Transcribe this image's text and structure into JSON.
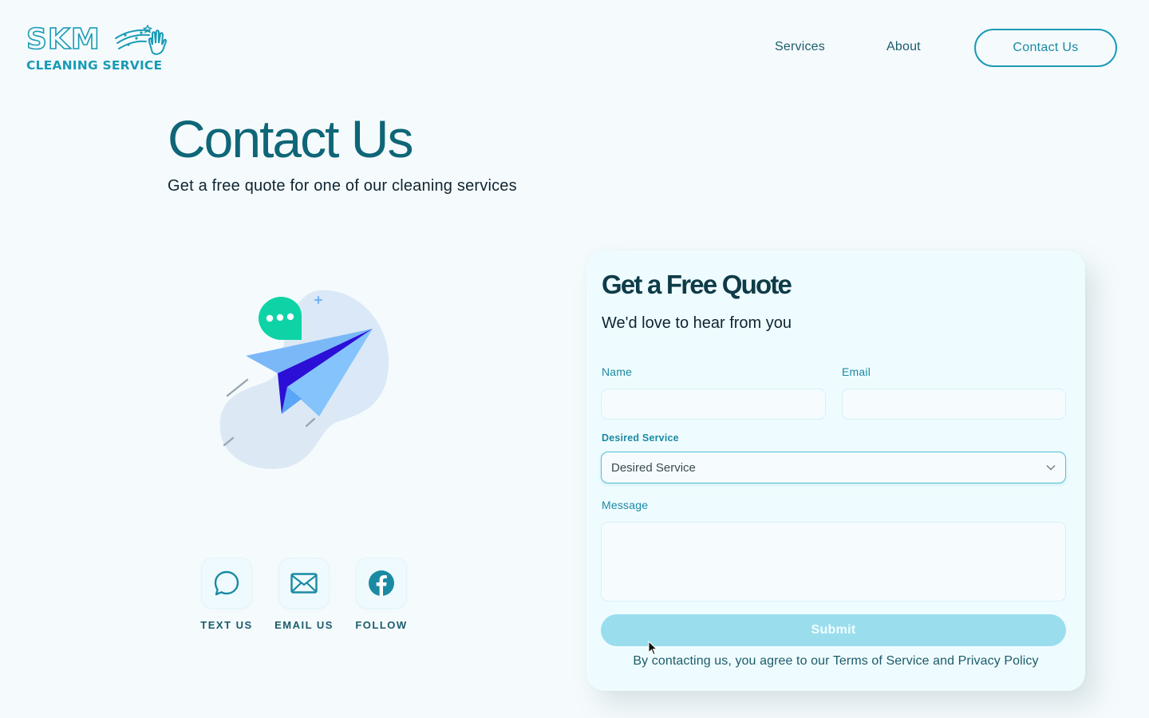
{
  "brand": {
    "name_top": "SKM",
    "name_bottom": "CLEANING SERVICE",
    "primary_color": "#1a9bb5",
    "heading_color": "#0e6677"
  },
  "nav": {
    "items": [
      {
        "label": "Services"
      },
      {
        "label": "About"
      }
    ],
    "cta_label": "Contact Us"
  },
  "hero": {
    "title": "Contact Us",
    "subtitle": "Get a free quote for one of our cleaning services"
  },
  "illustration": {
    "icon": "paper-plane-with-chat-bubble"
  },
  "contact_methods": [
    {
      "label": "TEXT US",
      "icon": "chat-bubble-icon"
    },
    {
      "label": "EMAIL US",
      "icon": "envelope-icon"
    },
    {
      "label": "FOLLOW",
      "icon": "facebook-icon"
    }
  ],
  "form": {
    "title": "Get a Free Quote",
    "subtitle": "We'd love to hear from you",
    "name_label": "Name",
    "name_value": "",
    "email_label": "Email",
    "email_value": "",
    "service_label": "Desired Service",
    "service_selected": "Desired Service",
    "message_label": "Message",
    "message_value": "",
    "submit_label": "Submit",
    "terms_text": "By contacting us, you agree to our Terms of Service and Privacy Policy"
  }
}
